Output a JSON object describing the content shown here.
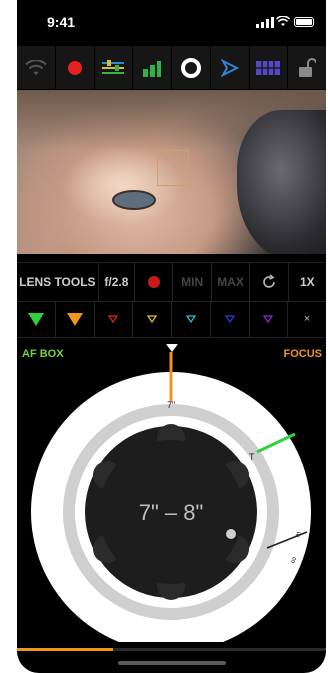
{
  "status_bar": {
    "time": "9:41"
  },
  "toolbar": {
    "icons": [
      "wifi-icon",
      "record-icon",
      "settings-sliders-icon",
      "levels-icon",
      "circle-icon",
      "play-icon",
      "grid-icon",
      "unlock-icon"
    ]
  },
  "lens_tools": {
    "label": "LENS TOOLS",
    "aperture": "f/2.8",
    "min_label": "MIN",
    "max_label": "MAX",
    "zoom": "1X",
    "close_label": "×"
  },
  "focus_dial": {
    "af_box_label": "AF BOX",
    "focus_label": "FOCUS",
    "range_text": "7\" – 8\"",
    "ring_mark_near": "7\"",
    "ring_mark_green": "T",
    "ring_mark_far": "∞",
    "ring_mark_right": "m"
  },
  "colors": {
    "accent_orange": "#f0951f",
    "accent_green": "#7cd134",
    "record_red": "#e52222"
  },
  "progress": {
    "fraction": 0.31
  }
}
